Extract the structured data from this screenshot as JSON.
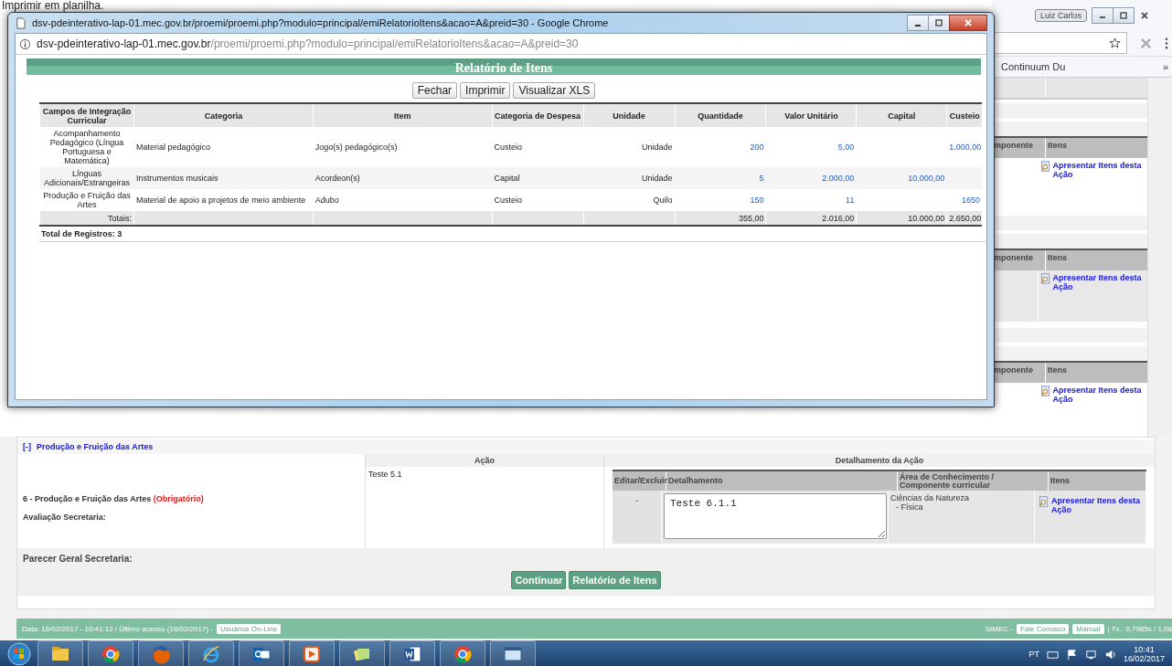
{
  "background_text": "Imprimir em planilha.",
  "popup": {
    "title": "dsv-pdeinterativo-lap-01.mec.gov.br/proemi/proemi.php?modulo=principal/emiRelatorioItens&acao=A&preid=30 - Google Chrome",
    "url_host": "dsv-pdeinterativo-lap-01.mec.gov.br",
    "url_path": "/proemi/proemi.php?modulo=principal/emiRelatorioItens&acao=A&preid=30",
    "heading": "Relatório de Itens",
    "buttons": [
      "Fechar",
      "Imprimir",
      "Visualizar XLS"
    ],
    "table": {
      "columns": [
        "Campos de Integração Curricular",
        "Categoria",
        "Item",
        "Categoria de Despesa",
        "Unidade",
        "Quantidade",
        "Valor Unitário",
        "Capital",
        "Custeio"
      ],
      "rows": [
        {
          "campo": "Acompanhamento Pedagógico (Língua Portuguesa e Matemática)",
          "categoria": "Material pedagógico",
          "item": "Jogo(s) pedagógico(s)",
          "despesa": "Custeio",
          "unidade": "Unidade",
          "quantidade": "200",
          "valor_unitario": "5,00",
          "custeio": "1.000,00"
        },
        {
          "campo": "Línguas Adicionais/Estrangeiras",
          "categoria": "Instrumentos musicais",
          "item": "Acordeon(s)",
          "despesa": "Capital",
          "unidade": "Unidade",
          "quantidade": "5",
          "valor_unitario": "2.000,00",
          "capital": "10.000,00"
        },
        {
          "campo": "Produção e Fruição das Artes",
          "categoria": "Material de apoio a projetos de meio ambiente",
          "item": "Adubo",
          "despesa": "Custeio",
          "unidade": "Quilo",
          "quantidade": "150",
          "valor_unitario": "11",
          "custeio": "1650"
        }
      ],
      "totals": {
        "label": "Totais:",
        "values": [
          "355,00",
          "2.016,00",
          "10.000,00",
          "2.650,00"
        ]
      }
    },
    "total_records": "Total de Registros: 3"
  },
  "browser": {
    "user": "Luiz Carlos",
    "bookmark": "Continuum Du",
    "bookmark_more": "»"
  },
  "right_sections": [
    {
      "column_1": "mponente",
      "column_2": "Itens",
      "link": "Apresentar Itens desta Ação"
    },
    {
      "column_1": "mponente",
      "column_2": "Itens",
      "link": "Apresentar Itens desta Ação"
    },
    {
      "column_1": "mponente",
      "column_2": "Itens",
      "link": "Apresentar Itens desta Ação"
    }
  ],
  "section": {
    "toggle": "[-]",
    "title": "Produção e Fruição das Artes",
    "acao_header": "Ação",
    "detail_header": "Detalhamento da Ação",
    "item_label": "6 - Produção e Fruição das Artes",
    "required": "(Obrigatório)",
    "evaluation_label": "Avaliação Secretaria:",
    "acao_text": "Teste 5.1",
    "detail_columns": [
      "Editar/Excluir",
      "Detalhamento",
      "Área de Conhecimento / Componente curricular",
      "Itens"
    ],
    "detail_row": {
      "edit": "-",
      "detail": "Teste 6.1.1",
      "area": "Ciências da Natureza",
      "sub_area": "- Física",
      "link": "Apresentar Itens desta Ação"
    }
  },
  "parecer_label": "Parecer Geral Secretaria:",
  "actions": [
    "Continuar",
    "Relatório de Itens"
  ],
  "footer": {
    "info": "Data: 16/02/2017 - 10:41:12 / Último acesso (16/02/2017) -",
    "online_button": "Usuários On-Line",
    "system": "SIMEC -",
    "links": [
      "Fale Conosco",
      "Manual"
    ],
    "timing": "| Tx.: 0,7985s / 1,08"
  },
  "taskbar": {
    "language": "PT",
    "time": "10:41",
    "date": "16/02/2017"
  }
}
